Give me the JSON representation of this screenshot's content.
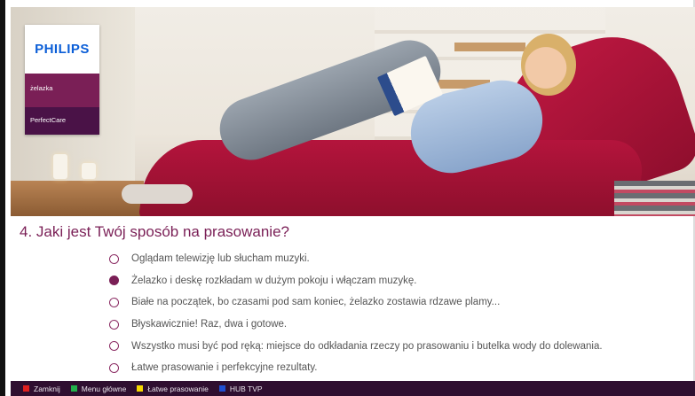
{
  "brand": {
    "logo": "PHILIPS",
    "category": "żelazka",
    "product_line": "PerfectCare"
  },
  "question": {
    "title": "4. Jaki jest Twój sposób na prasowanie?",
    "selected_index": 1,
    "options": [
      "Oglądam telewizję lub słucham muzyki.",
      "Żelazko i deskę rozkładam w dużym pokoju i włączam muzykę.",
      "Białe na początek, bo czasami pod sam koniec, żelazko zostawia rdzawe plamy...",
      "Błyskawicznie! Raz, dwa i gotowe.",
      "Wszystko musi być pod ręką: miejsce do odkładania rzeczy po prasowaniu i butelka wody do dolewania.",
      "Łatwe prasowanie i perfekcyjne rezultaty."
    ]
  },
  "colors": {
    "accent": "#7a1f56",
    "bar_bg": "#2f0f30",
    "logo_blue": "#0b5ed7"
  },
  "bottom_bar": {
    "keys": [
      {
        "color": "#e02020",
        "label": "Zamknij",
        "icon": "red-key-icon"
      },
      {
        "color": "#22b14c",
        "label": "Menu główne",
        "icon": "green-key-icon"
      },
      {
        "color": "#f5d800",
        "label": "Łatwe prasowanie",
        "icon": "yellow-key-icon"
      },
      {
        "color": "#1f4fd1",
        "label": "HUB TVP",
        "icon": "blue-key-icon"
      }
    ]
  }
}
